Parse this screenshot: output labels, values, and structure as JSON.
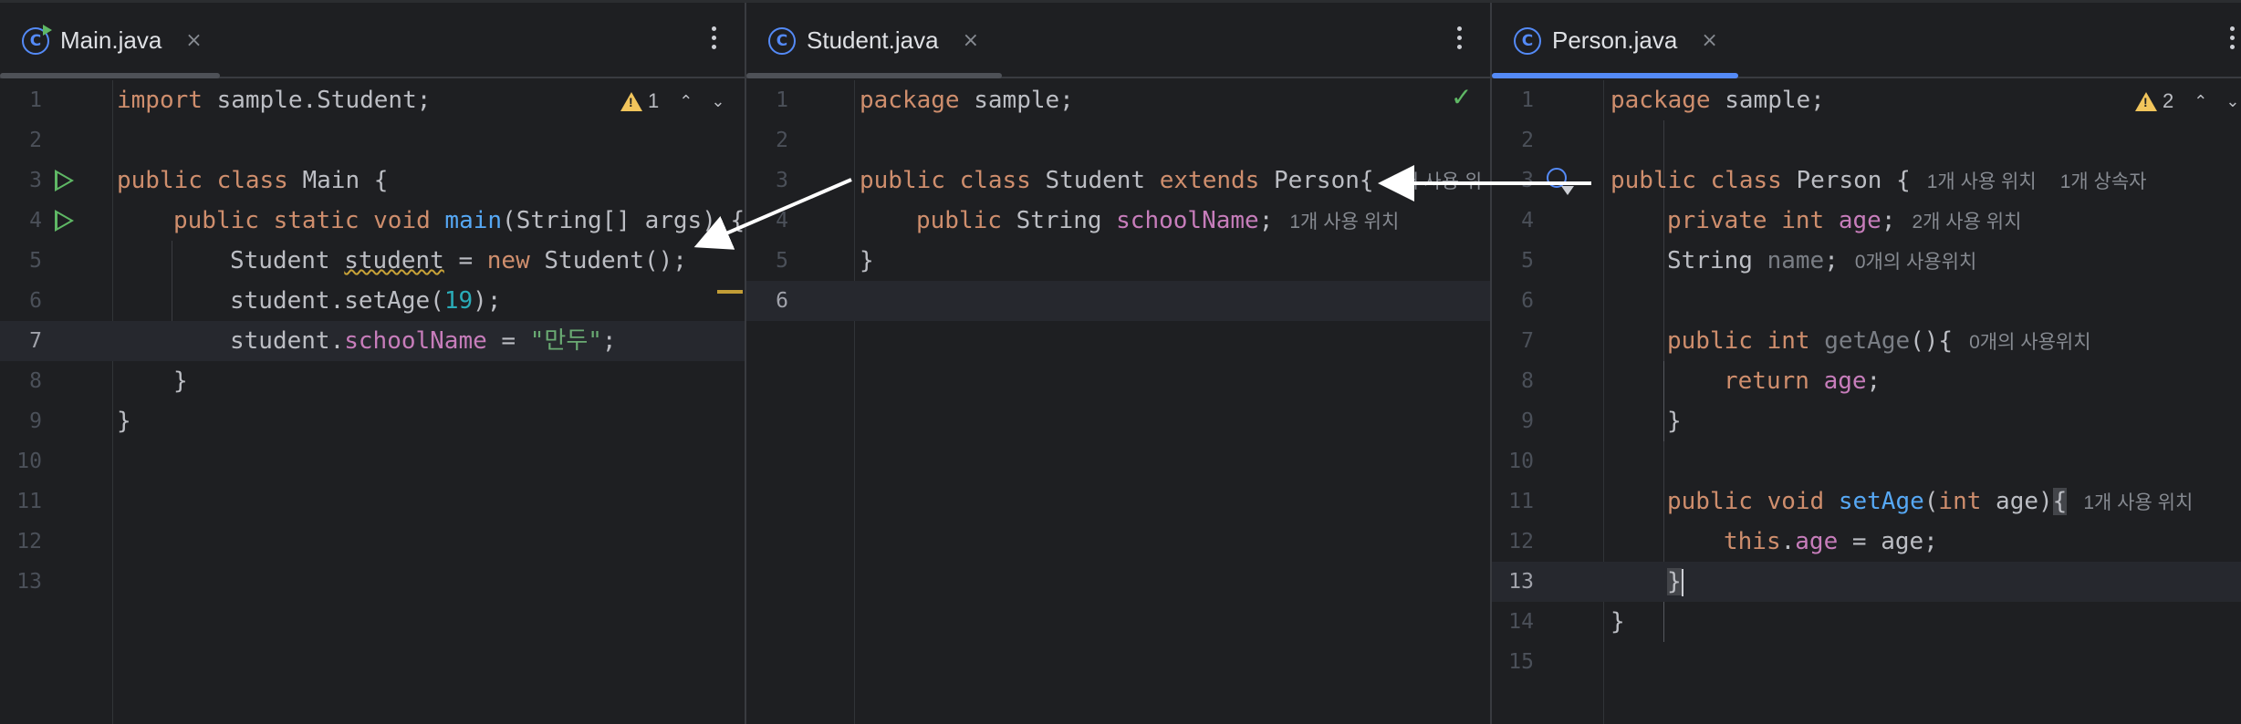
{
  "panes": {
    "main": {
      "tab": {
        "label": "Main.java",
        "icon": "class-run-icon",
        "close": "×"
      },
      "warnings": {
        "count": "1"
      },
      "lines": [
        "1",
        "2",
        "3",
        "4",
        "5",
        "6",
        "7",
        "8",
        "9",
        "10",
        "11",
        "12",
        "13"
      ],
      "code": {
        "l1_kw": "import",
        "l1_rest": " sample.Student;",
        "l3_kw": "public class",
        "l3_rest": " Main {",
        "l4_kw": "public static void",
        "l4_fn": "main",
        "l4_rest": "(String[] args) {",
        "l5_type": "Student ",
        "l5_var": "student",
        "l5_mid": " = ",
        "l5_kw": "new",
        "l5_rest": " Student();",
        "l6_pre": "student.setAge(",
        "l6_num": "19",
        "l6_post": ");",
        "l7_pre": "student.",
        "l7_fld": "schoolName",
        "l7_mid": " = ",
        "l7_str": "\"만두\"",
        "l7_post": ";",
        "l8": "}",
        "l9": "}"
      }
    },
    "student": {
      "tab": {
        "label": "Student.java",
        "icon": "class-icon",
        "close": "×"
      },
      "lines": [
        "1",
        "2",
        "3",
        "4",
        "5",
        "6"
      ],
      "code": {
        "l1_kw": "package",
        "l1_rest": " sample;",
        "l3_kw1": "public class",
        "l3_mid": " Student ",
        "l3_kw2": "extends",
        "l3_rest": " Person{",
        "l3_hint": "1개 사용 위",
        "l4_kw": "public",
        "l4_type": " String ",
        "l4_fld": "schoolName",
        "l4_post": ";",
        "l4_hint": "1개 사용 위치",
        "l5": "}"
      }
    },
    "person": {
      "tab": {
        "label": "Person.java",
        "icon": "class-icon",
        "close": "×"
      },
      "warnings": {
        "count": "2"
      },
      "lines": [
        "1",
        "2",
        "3",
        "4",
        "5",
        "6",
        "7",
        "8",
        "9",
        "10",
        "11",
        "12",
        "13",
        "14",
        "15"
      ],
      "code": {
        "l1_kw": "package",
        "l1_rest": " sample;",
        "l3_kw": "public class",
        "l3_rest": " Person {",
        "l3_hint1": "1개 사용 위치",
        "l3_hint2": "1개 상속자",
        "l4_kw": "private int",
        "l4_fld": " age",
        "l4_post": ";",
        "l4_hint": "2개 사용 위치",
        "l5_type": "String ",
        "l5_fld": "name",
        "l5_post": ";",
        "l5_hint": "0개의 사용위치",
        "l7_kw": "public int",
        "l7_fn": " getAge",
        "l7_post": "(){",
        "l7_hint": "0개의 사용위치",
        "l8_kw": "return",
        "l8_fld": " age",
        "l8_post": ";",
        "l9": "}",
        "l11_kw": "public void",
        "l11_fn": " setAge",
        "l11_p1": "(",
        "l11_kw2": "int",
        "l11_p2": " age)",
        "l11_brace": "{",
        "l11_hint": "1개 사용 위치",
        "l12_kw": "this",
        "l12_dot": ".",
        "l12_fld": "age",
        "l12_post": " = age;",
        "l13": "}",
        "l14": "}"
      }
    }
  },
  "colors": {
    "background": "#1e1f22",
    "keyword": "#cf8e6d",
    "function": "#56a8f5",
    "field": "#c77dbb",
    "string": "#6aab73",
    "number": "#2aacb8",
    "accent": "#548af7"
  }
}
